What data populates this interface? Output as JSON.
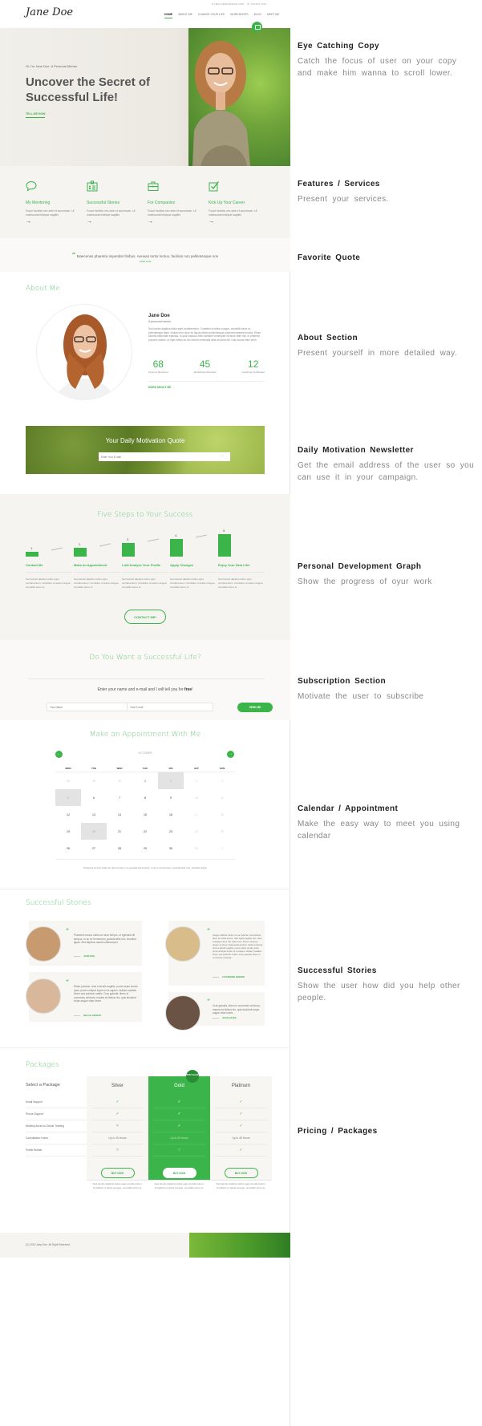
{
  "header": {
    "logo": "Jane Doe",
    "email": "✉ HELLO@EXAMPLE.COM",
    "phone": "☏ 734 264 7792",
    "nav": [
      "HOME",
      "ABOUT ME",
      "CHANGE YOUR LIFE",
      "WORKSHOPS",
      "BLOG",
      "MEET ME"
    ]
  },
  "hero": {
    "subtitle": "Hi, I'm Jane Doe. A Personal Mentor",
    "title": "Uncover the Secret of Successful Life!",
    "cta": "TELL ME HOW"
  },
  "features": [
    {
      "icon": "speech-bubble-icon",
      "title": "My Mentoring",
      "text": "Fusce facilisis nec ante et accumsan. Ut malesuada tristique sagittis",
      "arrow": "→"
    },
    {
      "icon": "id-card-icon",
      "title": "Successful Stories",
      "text": "Fusce facilisis nec ante et accumsan. Ut malesuada tristique sagittis",
      "arrow": "→"
    },
    {
      "icon": "briefcase-icon",
      "title": "For Companies",
      "text": "Fusce facilisis nec ante et accumsan. Ut malesuada tristique sagittis",
      "arrow": "→"
    },
    {
      "icon": "checkbox-icon",
      "title": "Kick Up Your Career",
      "text": "Fusce facilisis nec ante et accumsan. Ut malesuada tristique sagittis",
      "arrow": "→"
    }
  ],
  "quote": {
    "mark": "“",
    "text": "Maecenas pharetra imperdiet finibus. Aenean tortor lectus, facilisis non pellentesque non",
    "author": "JANE DOE"
  },
  "about": {
    "title": "About Me",
    "name": "Jane Doe",
    "role": "A personal mentor",
    "text": "Sed iaculis dapibus tellus eget condimentum. Curabitur ut tellus congue, convallis tortor et, pellentesque diam. Nullam non dolor eu ligula ultrices pellentesque placerat imperdiet metus. Etiam lobortis bibendum egestas. In quis massa a felis molestie consequat rhoncus vitae nisl. In pharetra posuere dictum. In eget metus eu leo rutrum venenatis vitae sit amet elit. Duis luctus enim enim.",
    "stats": [
      {
        "value": "68",
        "label": "Persons Mentored"
      },
      {
        "value": "45",
        "label": "Workshops Attended"
      },
      {
        "value": "12",
        "label": "Coaching Certificates"
      }
    ],
    "more": "MORE ABOUT ME  →"
  },
  "motivation": {
    "title": "Your Daily Motivation Quote",
    "placeholder": "Enter Your E-mail",
    "submit": "→"
  },
  "steps": {
    "title": "Five Steps to Your Success",
    "items": [
      {
        "num": "1.",
        "label": "Contact Me",
        "level": 1,
        "text": "Sed iaculis dapibus tellus eget condimentum. Curabitur ut tellus congue, convallis tortor et."
      },
      {
        "num": "2.",
        "label": "Make an Appointment",
        "level": 2,
        "text": "Sed iaculis dapibus tellus eget condimentum. Curabitur ut tellus congue, convallis tortor et."
      },
      {
        "num": "3.",
        "label": "I will Analyze Your Profile",
        "level": 3,
        "text": "Sed iaculis dapibus tellus eget condimentum. Curabitur ut tellus congue, convallis tortor et."
      },
      {
        "num": "4.",
        "label": "Apply Changes",
        "level": 4,
        "text": "Sed iaculis dapibus tellus eget condimentum. Curabitur ut tellus congue, convallis tortor et."
      },
      {
        "num": "5.",
        "label": "Enjoy Your New Life!",
        "level": 5,
        "text": "Sed iaculis dapibus tellus eget condimentum. Curabitur ut tellus congue, convallis tortor et."
      }
    ],
    "max_level": 5,
    "cta": "CONTACT ME!"
  },
  "subscribe": {
    "title": "Do You Want a Successful Life?",
    "text_before": "Enter your name and e-mail and I will tell you for ",
    "text_bold": "free",
    "text_after": "!",
    "name_placeholder": "Your Name",
    "email_placeholder": "Your E-mail",
    "button": "SEND ME"
  },
  "calendar": {
    "title": "Make an Appointment With Me",
    "month": "OCTOBER",
    "prev": "←",
    "next": "→",
    "weekdays": [
      "MON",
      "TUE",
      "WED",
      "THU",
      "FRI",
      "SAT",
      "SUN"
    ],
    "weeks": [
      [
        {
          "d": "28",
          "m": true
        },
        {
          "d": "29",
          "m": true
        },
        {
          "d": "30",
          "m": true
        },
        {
          "d": "1"
        },
        {
          "d": "2",
          "s": true
        },
        {
          "d": "3",
          "m": true
        },
        {
          "d": "4",
          "m": true
        }
      ],
      [
        {
          "d": "5",
          "s": true
        },
        {
          "d": "6"
        },
        {
          "d": "7"
        },
        {
          "d": "8"
        },
        {
          "d": "9"
        },
        {
          "d": "10",
          "m": true
        },
        {
          "d": "11",
          "m": true
        }
      ],
      [
        {
          "d": "12"
        },
        {
          "d": "13"
        },
        {
          "d": "14"
        },
        {
          "d": "15"
        },
        {
          "d": "16"
        },
        {
          "d": "17",
          "m": true
        },
        {
          "d": "18",
          "m": true
        }
      ],
      [
        {
          "d": "19"
        },
        {
          "d": "20",
          "s": true
        },
        {
          "d": "21"
        },
        {
          "d": "22"
        },
        {
          "d": "23"
        },
        {
          "d": "24",
          "m": true
        },
        {
          "d": "25",
          "m": true
        }
      ],
      [
        {
          "d": "26"
        },
        {
          "d": "27"
        },
        {
          "d": "28"
        },
        {
          "d": "29"
        },
        {
          "d": "30"
        },
        {
          "d": "31",
          "m": true
        },
        {
          "d": "1",
          "m": true
        }
      ]
    ],
    "note": "Praesent cursus nulla non arcu tempor, ut egestas elit tempus. In ac ex fermentum, gravida felis nec, tincidunt ligula"
  },
  "stories": {
    "title": "Successful Stories",
    "items": [
      {
        "text": "Praesent cursus nulla non arcu tempor, ut egestas elit tempus. In ac ex fermentum, gravida felis nec, tincidunt ligula. Sed dapibus mauris ullamcorper.",
        "name": "JANE DOE"
      },
      {
        "text": "Etiam pulvinar, urna a iaculis sagittis, purus turpis ornare justo, porta volutpat turpis mi et sapien. Nullam sodales lorem sed pulvinar mattis. Cras gravida, libero in commodo vehicula, mauris mi finibus leo, quis tincidunt turpis augue vitae lorem.",
        "name": "NELLIE GIBSON"
      },
      {
        "text": "Integer efficitur dictum mi ac lobortis. Sed finibus, diam id mollis auctor, odio ligula sagittis nisl, vitae volutpat metus nisi vitae risus. Donec tempus augue sit amet malesuada pretium. Etiam pulvinar, urna a iaculis sagittis, purus turpis ornare justo, porta volutpat turpis mi et sapien. Nullam sodales lorem sed pulvinar mattis. Cras gravida, libero in commodo vehicula.",
        "name": "CATHERINE BROWN"
      },
      {
        "text": "Cras gravida, libero in commodo vehicula, mauris mi finibus leo, quis tincidunt turpis augue vitae lorem.",
        "name": "JACK HAYES"
      }
    ]
  },
  "packages": {
    "title": "Packages",
    "select_label": "Select a Package",
    "features": [
      "Email Support",
      "Phone Support",
      "Monthly Acces to Online Training",
      "Consultation Hours",
      "Profile Builder"
    ],
    "badge": "BEST VALUE",
    "plans": [
      {
        "name": "Silver",
        "values": [
          "✓",
          "✓",
          "✕",
          "Up to 15 Hours",
          "✕"
        ],
        "button": "BUY NOW",
        "note": "Sed iaculis dapibus tellus eget condimentum. Curabitur ut tellus congue, convallis tortor et."
      },
      {
        "name": "Gold",
        "values": [
          "✓",
          "✓",
          "✓",
          "Up to 30 Hours",
          "✕"
        ],
        "button": "BUY NOW",
        "note": "Sed iaculis dapibus tellus eget condimentum. Curabitur ut tellus congue, convallis tortor et."
      },
      {
        "name": "Platinum",
        "values": [
          "✓",
          "✓",
          "✓",
          "Up to 45 Hours",
          "✓"
        ],
        "button": "BUY NOW",
        "note": "Sed iaculis dapibus tellus eget condimentum. Curabitur ut tellus congue, convallis tortor et."
      }
    ]
  },
  "footer": {
    "copyright": "(C) 2015 Jane Doe. All Right Reserved"
  },
  "annotations": [
    {
      "title": "Eye Catching Copy",
      "text": "Catch the focus of user on your copy and make him wanna to scroll lower."
    },
    {
      "title": "Features / Services",
      "text": "Present your services."
    },
    {
      "title": "Favorite Quote",
      "text": ""
    },
    {
      "title": "About Section",
      "text": "Present yourself in more detailed way."
    },
    {
      "title": "Daily Motivation Newsletter",
      "text": "Get the email address of the user so you can use it in your campaign."
    },
    {
      "title": "Personal Development Graph",
      "text": "Show the progress of oyur work"
    },
    {
      "title": "Subscription Section",
      "text": "Motivate the user to subscribe"
    },
    {
      "title": "Calendar / Appointment",
      "text": "Make the easy way to meet you using calendar"
    },
    {
      "title": "Successful Stories",
      "text": "Show the user how did you help other people."
    },
    {
      "title": "Pricing / Packages",
      "text": ""
    }
  ]
}
